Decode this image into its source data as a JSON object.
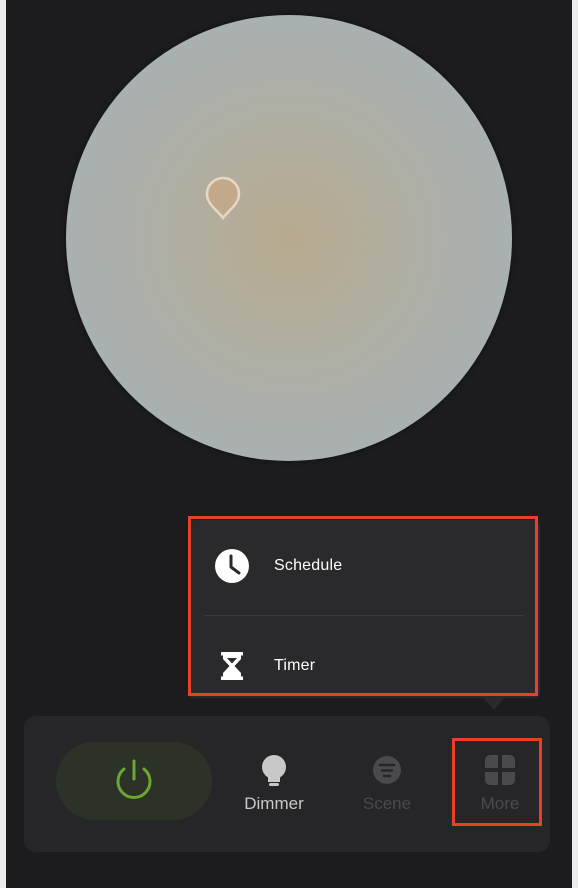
{
  "light": {
    "preview_icon": "color-picker-drop-icon",
    "colors": {
      "center": "#b8aa8f",
      "edge": "#a6adb0"
    }
  },
  "popup_menu": {
    "items": [
      {
        "label": "Schedule",
        "icon": "clock-icon"
      },
      {
        "label": "Timer",
        "icon": "hourglass-icon"
      }
    ]
  },
  "bottom_bar": {
    "power": {
      "icon": "power-icon",
      "state": "on",
      "color": "#6aa832"
    },
    "tabs": [
      {
        "label": "Dimmer",
        "icon": "bulb-icon",
        "active": true
      },
      {
        "label": "Scene",
        "icon": "scene-icon",
        "active": false
      },
      {
        "label": "More",
        "icon": "grid-icon",
        "active": false
      }
    ]
  },
  "colors": {
    "background": "#1c1c1e",
    "highlight": "#e8402b",
    "accent": "#6aa832"
  }
}
